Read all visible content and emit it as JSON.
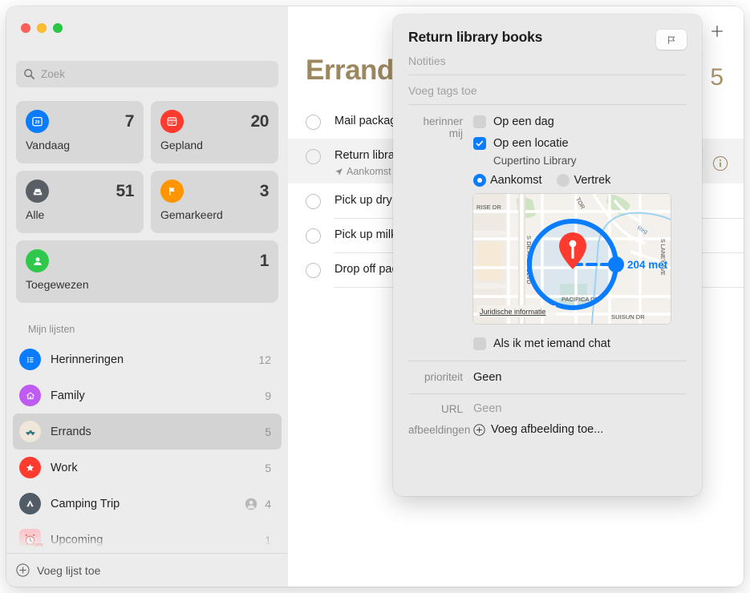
{
  "window": {
    "traffic_lights": [
      "close",
      "minimize",
      "zoom"
    ]
  },
  "sidebar": {
    "search": {
      "placeholder": "Zoek",
      "icon": "search-icon"
    },
    "smart_lists": [
      {
        "label": "Vandaag",
        "count": "7",
        "icon": "calendar-day-icon",
        "color": "#0a7cff"
      },
      {
        "label": "Gepland",
        "count": "20",
        "icon": "calendar-icon",
        "color": "#ff3b30"
      },
      {
        "label": "Alle",
        "count": "51",
        "icon": "inbox-tray-icon",
        "color": "#5a5f66"
      },
      {
        "label": "Gemarkeerd",
        "count": "3",
        "icon": "flag-icon",
        "color": "#ff9500"
      },
      {
        "label": "Toegewezen",
        "count": "1",
        "icon": "person-icon",
        "color": "#30c84b"
      }
    ],
    "my_lists_header": "Mijn lijsten",
    "lists": [
      {
        "name": "Herinneringen",
        "count": "12",
        "icon": "list-bullets-icon",
        "color": "#0a7cff",
        "shared": false,
        "selected": false
      },
      {
        "name": "Family",
        "count": "9",
        "icon": "house-icon",
        "color": "#bf5af2",
        "shared": false,
        "selected": false
      },
      {
        "name": "Errands",
        "count": "5",
        "icon": "pickup-truck-icon",
        "color": "#efe7d9",
        "shared": false,
        "selected": true
      },
      {
        "name": "Work",
        "count": "5",
        "icon": "star-icon",
        "color": "#ff3b30",
        "shared": false,
        "selected": false
      },
      {
        "name": "Camping Trip",
        "count": "4",
        "icon": "tent-icon",
        "color": "#515c66",
        "shared": true,
        "selected": false
      },
      {
        "name": "Upcoming",
        "count": "1",
        "icon": "alarm-clock-icon",
        "color": "#f9c7cb",
        "shared": false,
        "selected": false
      }
    ],
    "add_list": {
      "label": "Voeg lijst toe",
      "icon": "plus-circle-icon"
    }
  },
  "content": {
    "add_button_icon": "plus-icon",
    "title": "Errands",
    "count": "5",
    "title_color": "#9c875f",
    "info_button_icon": "info-circle-icon",
    "todos": [
      {
        "title": "Mail package",
        "sub": "",
        "selected": false,
        "sub_icon": ""
      },
      {
        "title": "Return library books",
        "sub": "Aankomst",
        "selected": true,
        "sub_icon": "location-arrow-icon"
      },
      {
        "title": "Pick up dry cleaning",
        "sub": "",
        "selected": false,
        "sub_icon": ""
      },
      {
        "title": "Pick up milk",
        "sub": "",
        "selected": false,
        "sub_icon": ""
      },
      {
        "title": "Drop off package",
        "sub": "",
        "selected": false,
        "sub_icon": ""
      }
    ]
  },
  "popover": {
    "title": "Return library books",
    "flag_button_icon": "flag-outline-icon",
    "notes_placeholder": "Notities",
    "tags_placeholder": "Voeg tags toe",
    "remind_label": "herinner mij",
    "on_a_day": {
      "label": "Op een dag",
      "checked": false
    },
    "on_a_location": {
      "label": "Op een locatie",
      "checked": true,
      "value": "Cupertino Library"
    },
    "arrive_label": "Aankomst",
    "leave_label": "Vertrek",
    "arrive_selected": true,
    "map": {
      "legal_label": "Juridische informatie",
      "distance_label": "204 met",
      "pin_icon": "map-pin-icon",
      "street_labels": [
        "RISE DR",
        "S DE ANZA BLVD",
        "TOR",
        "PACIFICA DR",
        "SUISUN DR",
        "Reg",
        "S LANEY AVE"
      ],
      "geofence_color": "#0a7cff"
    },
    "when_chatting": {
      "label": "Als ik met iemand chat",
      "checked": false
    },
    "priority": {
      "label": "prioriteit",
      "value": "Geen"
    },
    "url": {
      "label": "URL",
      "value": "Geen"
    },
    "images": {
      "label": "afbeeldingen",
      "action": "Voeg afbeelding toe...",
      "icon": "plus-circle-icon"
    }
  }
}
